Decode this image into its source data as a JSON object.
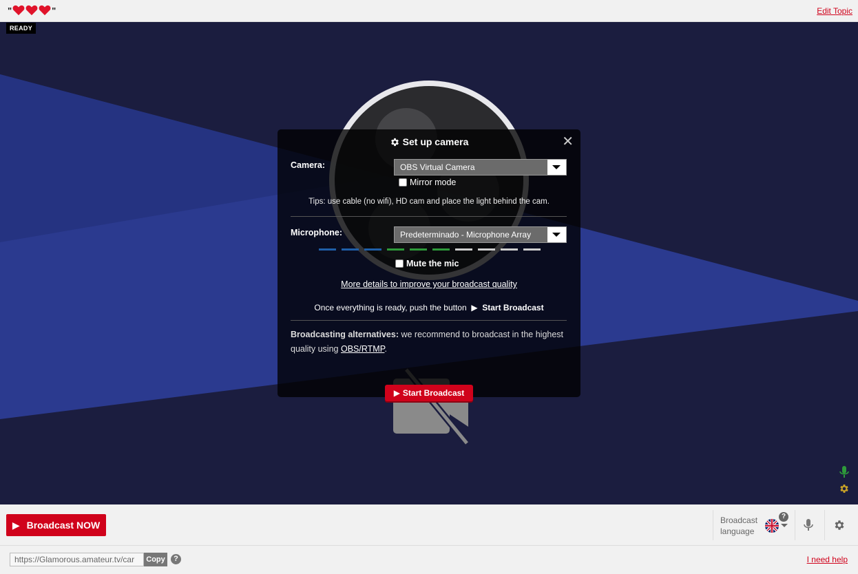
{
  "topbar": {
    "topic_open": "\"",
    "topic_close": "\"",
    "hearts": 3,
    "edit_topic": "Edit Topic"
  },
  "stage": {
    "status": "READY"
  },
  "modal": {
    "title": "Set up camera",
    "close": "✕",
    "camera_label": "Camera:",
    "camera_value": "OBS Virtual Camera",
    "mirror_label": "Mirror mode",
    "tips": "Tips: use cable (no wifi), HD cam and place the light behind the cam.",
    "microphone_label": "Microphone:",
    "microphone_value": "Predeterminado - Microphone Array",
    "mute_label": "Mute the mic",
    "more_link": "More details to improve your broadcast quality",
    "ready_text": "Once everything is ready, push the button",
    "ready_button_ref": "Start Broadcast",
    "alt_bold": "Broadcasting alternatives:",
    "alt_text": "we recommend to broadcast in the highest quality using",
    "alt_link": "OBS/RTMP",
    "alt_end": ".",
    "start_button": "Start Broadcast",
    "meter": {
      "segments": [
        "#1f5fa8",
        "#1f5fa8",
        "#1f5fa8",
        "#2e9a3a",
        "#2e9a3a",
        "#2e9a3a",
        "#cfcfcf",
        "#cfcfcf",
        "#cfcfcf",
        "#cfcfcf"
      ]
    }
  },
  "bottombar": {
    "broadcast_now": "Broadcast NOW",
    "lang_label": "Broadcast language",
    "lang_help": "?"
  },
  "footer": {
    "url_value": "https://Glamorous.amateur.tv/car",
    "copy": "Copy",
    "help": "?",
    "need_help": "I need help"
  },
  "colors": {
    "accent": "#d0021b",
    "stage": "#1b1d3f",
    "band": "#2b3a8f"
  }
}
